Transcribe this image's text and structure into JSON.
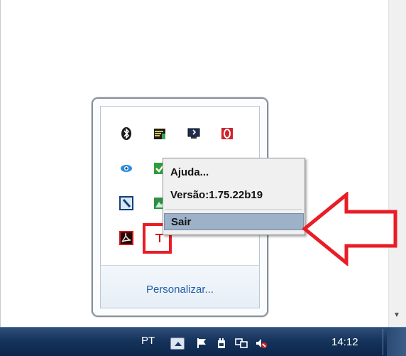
{
  "popup": {
    "customize_label": "Personalizar..."
  },
  "tray_icons": [
    "bluetooth-icon",
    "bars-app-icon",
    "display-icon",
    "red-loop-icon",
    "eye-icon",
    "green-check-icon",
    "wrench-icon",
    "green-mountain-icon",
    "acrobat-icon",
    "red-t-icon"
  ],
  "context_menu": {
    "items": [
      {
        "label": "Ajuda..."
      },
      {
        "label": "Versão:1.75.22b19"
      },
      {
        "label": "Sair"
      }
    ],
    "highlighted": "Sair"
  },
  "taskbar": {
    "language": "PT",
    "clock": "14:12",
    "icons": [
      "flag-icon",
      "power-plug-icon",
      "network-icon",
      "volume-muted-icon"
    ]
  },
  "colors": {
    "annotation_red": "#e81d25",
    "menu_highlight": "#9db2c8",
    "link_blue": "#1e5eaa"
  }
}
